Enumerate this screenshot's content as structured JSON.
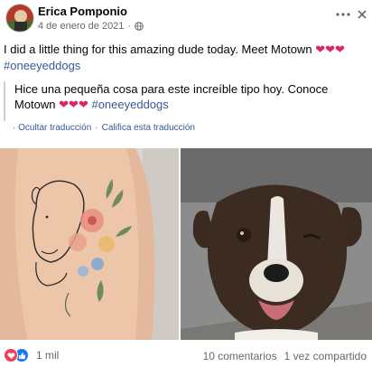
{
  "post": {
    "author": "Erica Pomponio",
    "date": "4 de enero de 2021",
    "text_main": "I did a little thing for this amazing dude today. Meet Motown",
    "hearts": "❤❤❤",
    "hashtag": "#oneeyeddogs",
    "translation_text": "Hice una pequeña cosa para este increíble tipo hoy. Conoce Motown",
    "translation_hashtag": "#oneeyeddogs",
    "hide_translation": "· Ocultar traducción",
    "rate_translation": "Califica esta traducción",
    "rate_separator": "·"
  },
  "footer": {
    "reaction_count": "1 mil",
    "comments": "10 comentarios",
    "shares": "1 vez compartido"
  },
  "icons": {
    "privacy": "globe-icon",
    "more": "more-dots-icon",
    "close": "close-icon",
    "reaction_love": "love-reaction-icon",
    "reaction_like": "like-reaction-icon"
  },
  "colors": {
    "link": "#385898",
    "secondary_text": "#65676b",
    "heart": "#e0245e",
    "like_blue": "#1877f2",
    "love_red": "#f33e58"
  }
}
